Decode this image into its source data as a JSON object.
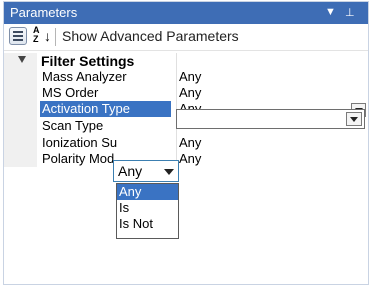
{
  "panel": {
    "title": "Parameters",
    "dropdown_icon": "chevron-down-icon",
    "pin_icon": "pin-icon"
  },
  "toolbar": {
    "categorized_icon": "categorized-view-icon",
    "sort_icon": "alphabetical-sort-icon",
    "sort_letter_top": "A",
    "sort_letter_bottom": "Z",
    "advanced_label": "Show Advanced Parameters"
  },
  "category": {
    "label": "Filter Settings"
  },
  "properties": [
    {
      "name": "Mass Analyzer",
      "value": "Any"
    },
    {
      "name": "MS Order",
      "value": "Any"
    },
    {
      "name": "Activation Type",
      "value": "Any"
    },
    {
      "name": "Scan Type",
      "value": ""
    },
    {
      "name": "Ionization Su",
      "value": "Any"
    },
    {
      "name": "Polarity Mod",
      "value": "Any"
    }
  ],
  "combo": {
    "value": "Any",
    "options": [
      "Any",
      "Is",
      "Is Not"
    ]
  },
  "colors": {
    "title_bar": "#3e6db5",
    "selection": "#3a73c3"
  }
}
